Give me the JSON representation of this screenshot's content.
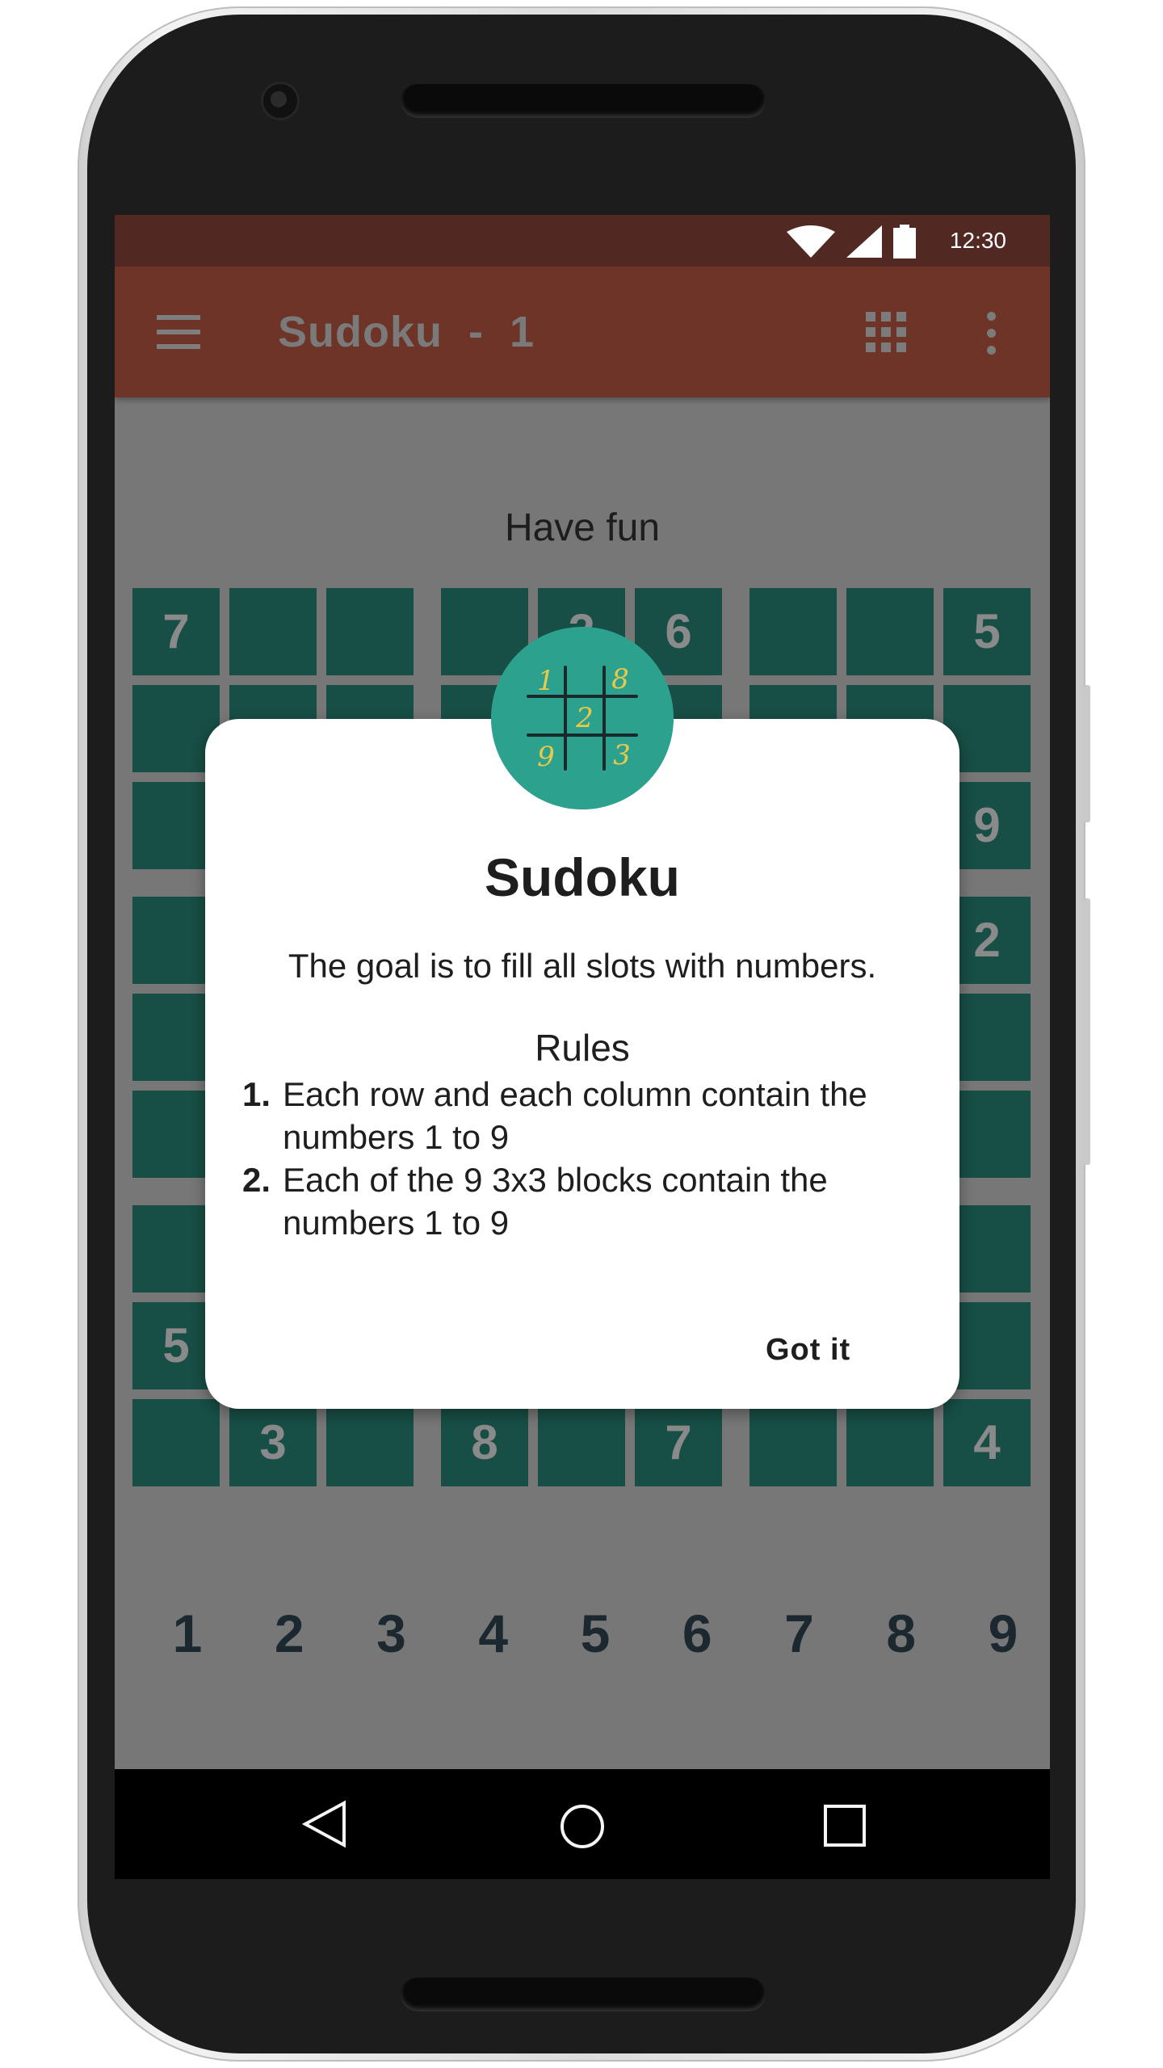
{
  "status_bar": {
    "time": "12:30"
  },
  "app_bar": {
    "title": "Sudoku  -  1"
  },
  "main": {
    "subtitle": "Have fun"
  },
  "board": {
    "cells": [
      [
        "7",
        "",
        "",
        "",
        "2",
        "6",
        "",
        "",
        "5"
      ],
      [
        "",
        "",
        "",
        "",
        "",
        "",
        "",
        "",
        ""
      ],
      [
        "",
        "",
        "",
        "",
        "",
        "",
        "",
        "",
        "9"
      ],
      [
        "",
        "",
        "",
        "",
        "",
        "",
        "",
        "",
        "2"
      ],
      [
        "",
        "",
        "",
        "",
        "",
        "",
        "",
        "",
        ""
      ],
      [
        "",
        "",
        "",
        "",
        "",
        "",
        "",
        "",
        ""
      ],
      [
        "",
        "",
        "",
        "",
        "",
        "",
        "",
        "",
        ""
      ],
      [
        "5",
        "",
        "",
        "",
        "",
        "",
        "",
        "",
        ""
      ],
      [
        "",
        "3",
        "",
        "8",
        "",
        "7",
        "",
        "",
        "4"
      ]
    ]
  },
  "numpad": {
    "keys": [
      "1",
      "2",
      "3",
      "4",
      "5",
      "6",
      "7",
      "8",
      "9"
    ]
  },
  "dialog": {
    "logo_digits": [
      "1",
      "8",
      "2",
      "9",
      "3"
    ],
    "title": "Sudoku",
    "goal": "The goal is to fill all slots with numbers.",
    "rules_heading": "Rules",
    "rules": [
      {
        "num": "1.",
        "text": "Each row and each column contain the numbers 1 to 9"
      },
      {
        "num": "2.",
        "text": "Each of the 9 3x3 blocks contain the numbers 1 to 9"
      }
    ],
    "confirm_label": "Got it"
  },
  "icons": {
    "menu": "hamburger-menu-icon",
    "grid": "grid-apps-icon",
    "more": "more-vert-icon",
    "back": "nav-back-icon",
    "home": "nav-home-icon",
    "recent": "nav-recent-icon"
  },
  "colors": {
    "status_bar": "#522922",
    "app_bar": "#6e3428",
    "cell": "#174e45",
    "dim_background": "#777777",
    "logo": "#2ca18e",
    "logo_digits": "#e9c94a"
  }
}
